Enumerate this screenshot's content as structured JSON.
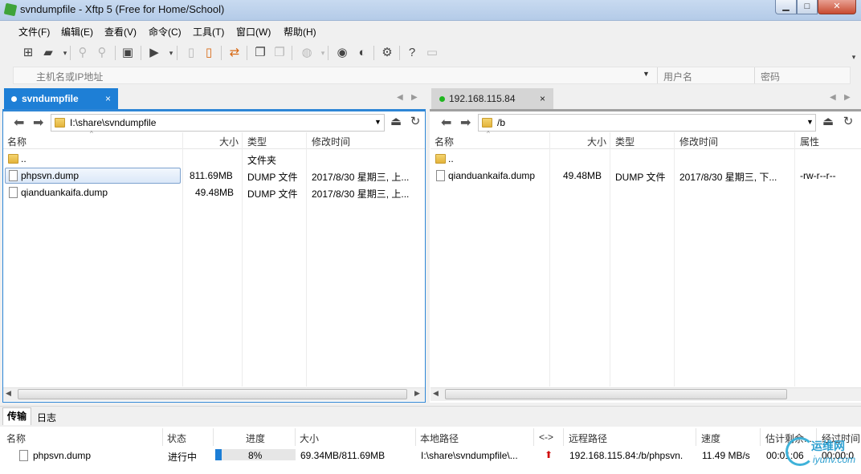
{
  "window": {
    "title": "svndumpfile - Xftp 5 (Free for Home/School)",
    "min": "▁",
    "max": "□",
    "close": "✕"
  },
  "menu": [
    "文件(F)",
    "编辑(E)",
    "查看(V)",
    "命令(C)",
    "工具(T)",
    "窗口(W)",
    "帮助(H)"
  ],
  "address": {
    "host_placeholder": "主机名或IP地址",
    "user_placeholder": "用户名",
    "password_placeholder": "密码"
  },
  "tabs": {
    "left": {
      "label": "svndumpfile",
      "close": "×"
    },
    "right": {
      "label": "192.168.115.84",
      "close": "×",
      "status_color": "#1fb61f"
    }
  },
  "local": {
    "path": "I:\\share\\svndumpfile",
    "columns": [
      "名称",
      "大小",
      "类型",
      "修改时间"
    ],
    "rows": [
      {
        "name": "..",
        "size": "",
        "type": "文件夹",
        "modified": ""
      },
      {
        "name": "phpsvn.dump",
        "size": "811.69MB",
        "type": "DUMP 文件",
        "modified": "2017/8/30 星期三, 上..."
      },
      {
        "name": "qianduankaifa.dump",
        "size": "49.48MB",
        "type": "DUMP 文件",
        "modified": "2017/8/30 星期三, 上..."
      }
    ]
  },
  "remote": {
    "path": "/b",
    "columns": [
      "名称",
      "大小",
      "类型",
      "修改时间",
      "属性"
    ],
    "rows": [
      {
        "name": "..",
        "size": "",
        "type": "",
        "modified": "",
        "attr": ""
      },
      {
        "name": "qianduankaifa.dump",
        "size": "49.48MB",
        "type": "DUMP 文件",
        "modified": "2017/8/30 星期三, 下...",
        "attr": "-rw-r--r--"
      }
    ]
  },
  "bottom_tabs": {
    "transfer": "传输",
    "log": "日志"
  },
  "transfers": {
    "columns": [
      "名称",
      "状态",
      "进度",
      "大小",
      "本地路径",
      "<->",
      "远程路径",
      "速度",
      "估计剩余...",
      "经过时间"
    ],
    "rows": [
      {
        "name": "phpsvn.dump",
        "status": "进行中",
        "progress": 0.08,
        "progress_label": "8%",
        "size": "69.34MB/811.69MB",
        "local_path": "I:\\share\\svndumpfile\\...",
        "remote_path": "192.168.115.84:/b/phpsvn.",
        "speed": "11.49 MB/s",
        "remaining": "00:01:06",
        "elapsed": "00:00:0"
      }
    ]
  },
  "watermark": {
    "name": "运维网",
    "domain": "iyunv.com"
  },
  "colors": {
    "accent": "#1e7fd6"
  }
}
